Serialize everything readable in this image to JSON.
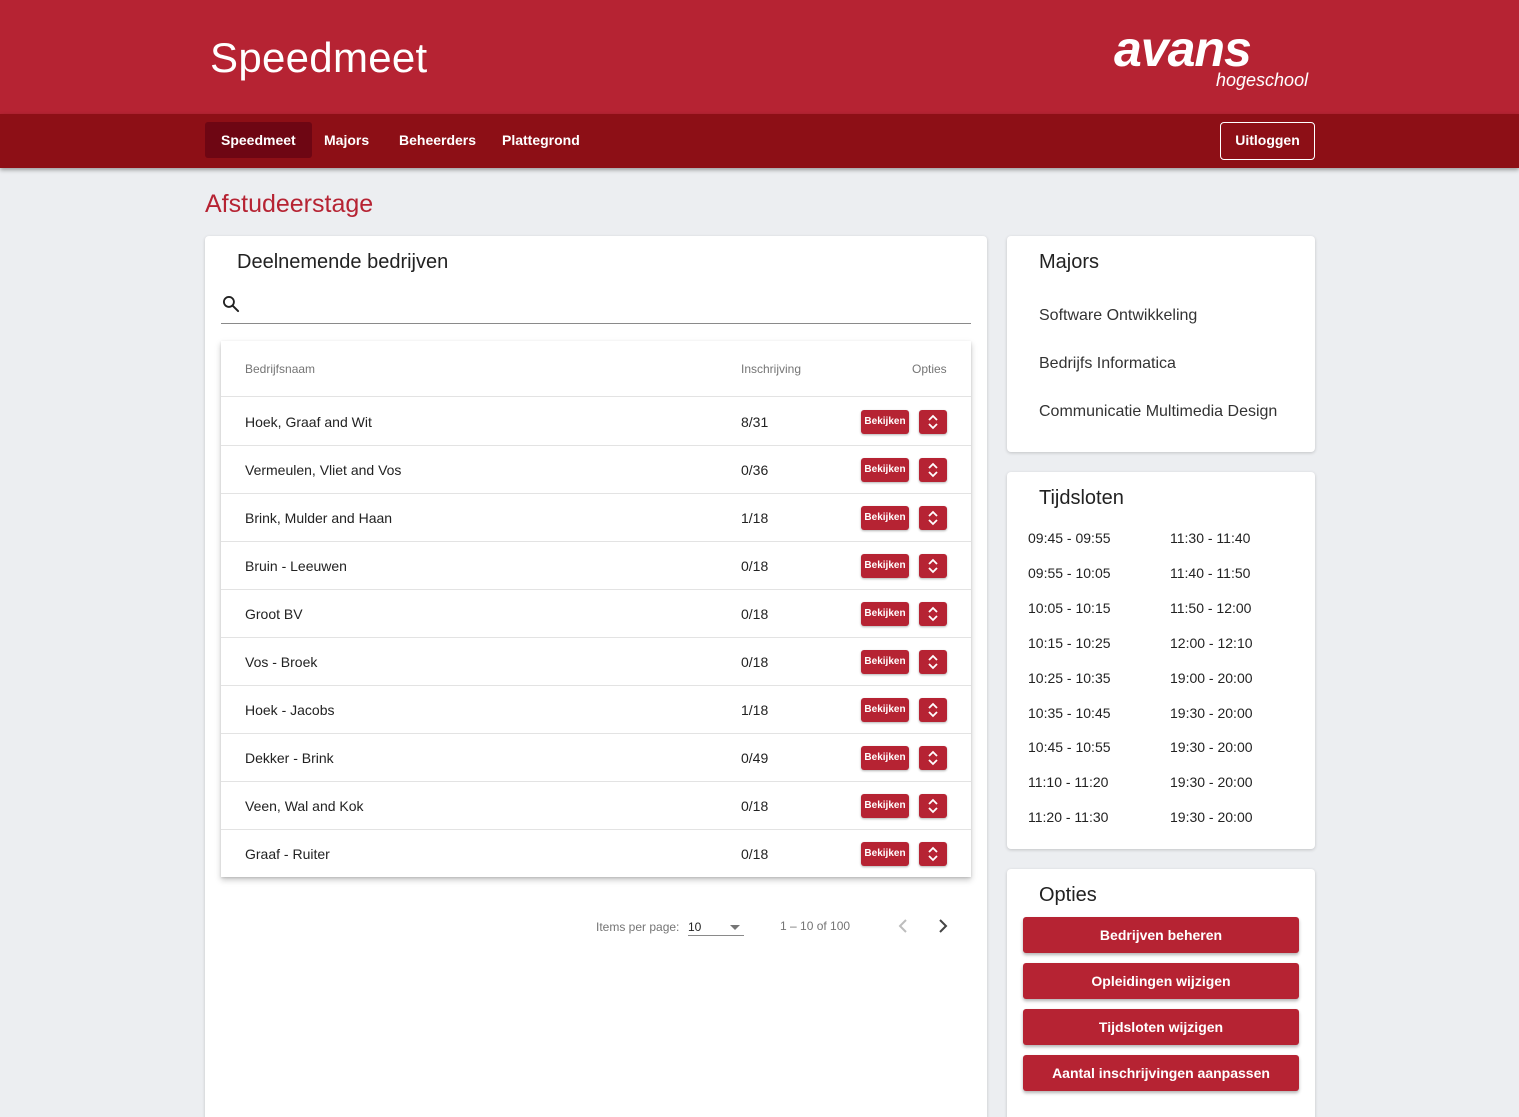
{
  "header": {
    "title": "Speedmeet",
    "logo_main": "avans",
    "logo_sub": "hogeschool"
  },
  "nav": {
    "items": [
      {
        "label": "Speedmeet",
        "active": true
      },
      {
        "label": "Majors",
        "active": false
      },
      {
        "label": "Beheerders",
        "active": false
      },
      {
        "label": "Plattegrond",
        "active": false
      }
    ],
    "logout_label": "Uitloggen"
  },
  "page": {
    "heading": "Afstudeerstage"
  },
  "companies": {
    "title": "Deelnemende bedrijven",
    "search_value": "",
    "columns": {
      "name": "Bedrijfsnaam",
      "registration": "Inschrijving",
      "options": "Opties"
    },
    "view_label": "Bekijken",
    "rows": [
      {
        "name": "Hoek, Graaf and Wit",
        "registration": "8/31"
      },
      {
        "name": "Vermeulen, Vliet and Vos",
        "registration": "0/36"
      },
      {
        "name": "Brink, Mulder and Haan",
        "registration": "1/18"
      },
      {
        "name": "Bruin - Leeuwen",
        "registration": "0/18"
      },
      {
        "name": "Groot BV",
        "registration": "0/18"
      },
      {
        "name": "Vos - Broek",
        "registration": "0/18"
      },
      {
        "name": "Hoek - Jacobs",
        "registration": "1/18"
      },
      {
        "name": "Dekker - Brink",
        "registration": "0/49"
      },
      {
        "name": "Veen, Wal and Kok",
        "registration": "0/18"
      },
      {
        "name": "Graaf - Ruiter",
        "registration": "0/18"
      }
    ],
    "paginator": {
      "items_per_page_label": "Items per page:",
      "page_size": "10",
      "range_label": "1 – 10 of 100"
    }
  },
  "majors": {
    "title": "Majors",
    "items": [
      "Software Ontwikkeling",
      "Bedrijfs Informatica",
      "Communicatie Multimedia Design"
    ]
  },
  "tijdsloten": {
    "title": "Tijdsloten",
    "left": [
      "09:45 - 09:55",
      "09:55 - 10:05",
      "10:05 - 10:15",
      "10:15 - 10:25",
      "10:25 - 10:35",
      "10:35 - 10:45",
      "10:45 - 10:55",
      "11:10 - 11:20",
      "11:20 - 11:30"
    ],
    "right": [
      "11:30 - 11:40",
      "11:40 - 11:50",
      "11:50 - 12:00",
      "12:00 - 12:10",
      "19:00 - 20:00",
      "19:30 - 20:00",
      "19:30 - 20:00",
      "19:30 - 20:00",
      "19:30 - 20:00"
    ]
  },
  "opties": {
    "title": "Opties",
    "buttons": [
      "Bedrijven beheren",
      "Opleidingen wijzigen",
      "Tijdsloten wijzigen",
      "Aantal inschrijvingen aanpassen"
    ]
  },
  "colors": {
    "brand": "#b62333",
    "brand_dark": "#8d0f16",
    "nav_active": "#6e0613",
    "background": "#eceef1"
  }
}
